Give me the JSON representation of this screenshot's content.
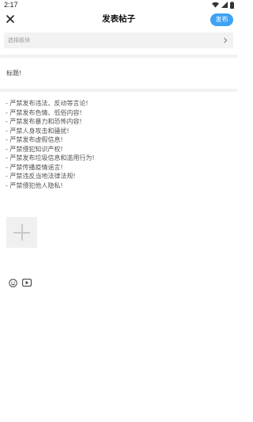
{
  "status_bar": {
    "time": "2:17",
    "icons": [
      "wifi-icon",
      "signal-icon",
      "battery-icon"
    ]
  },
  "header": {
    "title": "发表帖子",
    "close_icon": "close-icon",
    "publish_label": "发布",
    "accent_color": "#3ea2f5"
  },
  "section_picker": {
    "placeholder": "选择板块",
    "icon": "chevron-right-icon"
  },
  "title_field": {
    "label": "标题!"
  },
  "rules": [
    "- 严禁发布违法、反动等言论!",
    "- 严禁发布色情、低俗内容!",
    "- 严禁发布暴力和恐怖内容!",
    "- 严禁人身攻击和骚扰!",
    "- 严禁发布虚假信息!",
    "- 严禁侵犯知识产权!",
    "- 严禁发布垃圾信息和滥用行为!",
    "- 严禁传播疫情谣言!",
    "- 严禁违反当地法律法规!",
    "- 严禁侵犯他人隐私!"
  ],
  "add_image": {
    "icon": "plus-icon"
  },
  "toolbar": {
    "icons": [
      "emoji-icon",
      "video-icon"
    ]
  }
}
